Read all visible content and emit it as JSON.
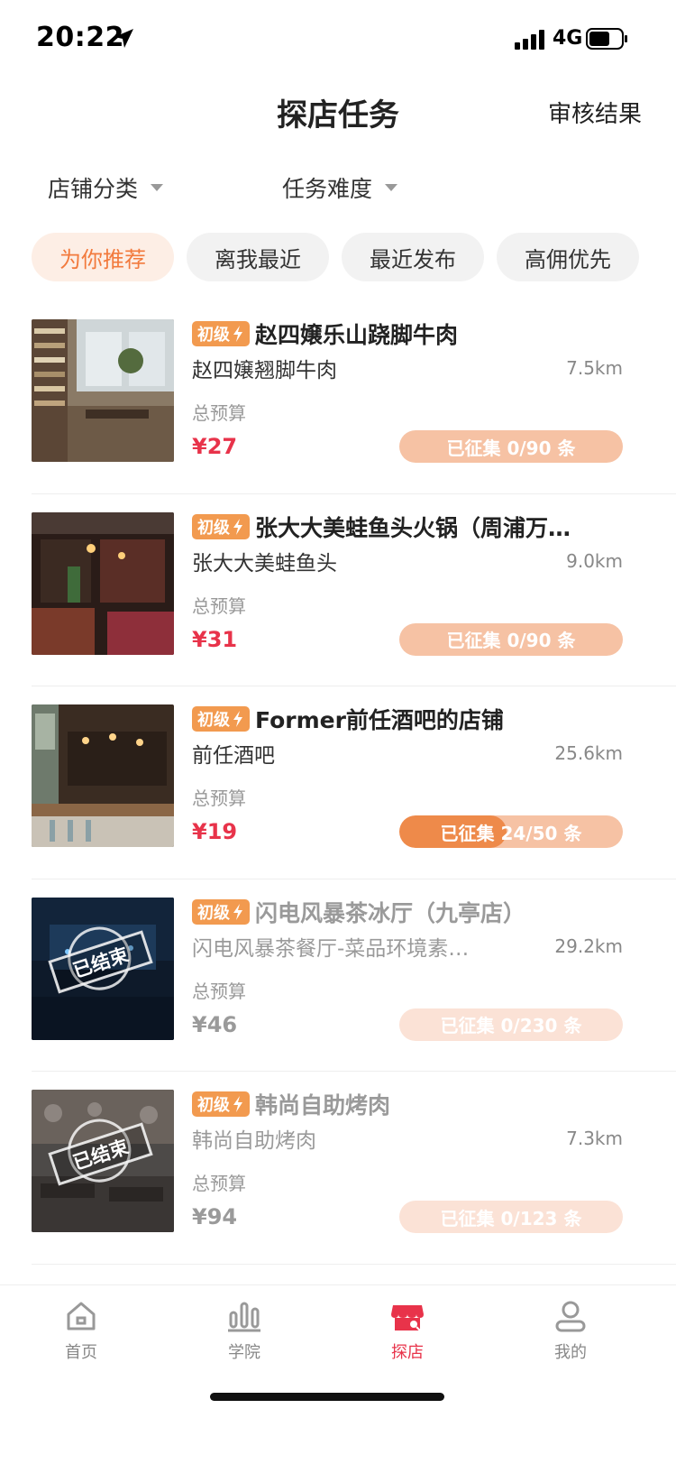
{
  "status_bar": {
    "time": "20:22",
    "network": "4G"
  },
  "header": {
    "title": "探店任务",
    "review_link": "审核结果"
  },
  "filters": {
    "category": "店铺分类",
    "difficulty": "任务难度"
  },
  "sort_tabs": [
    {
      "label": "为你推荐",
      "active": true
    },
    {
      "label": "离我最近",
      "active": false
    },
    {
      "label": "最近发布",
      "active": false
    },
    {
      "label": "高佣优先",
      "active": false
    }
  ],
  "tasks": [
    {
      "level": "初级",
      "title": "赵四嬢乐山跷脚牛肉",
      "store": "赵四嬢翘脚牛肉",
      "distance": "7.5km",
      "budget_label": "总预算",
      "price": "¥27",
      "progress": "已征集 0/90 条",
      "collected": 0,
      "total": 90,
      "ended": false,
      "image": "bookstore-cafe-photo"
    },
    {
      "level": "初级",
      "title": "张大大美蛙鱼头火锅（周浦万…",
      "store": "张大大美蛙鱼头",
      "distance": "9.0km",
      "budget_label": "总预算",
      "price": "¥31",
      "progress": "已征集 0/90 条",
      "collected": 0,
      "total": 90,
      "ended": false,
      "image": "restaurant-interior-photo"
    },
    {
      "level": "初级",
      "title": "Former前任酒吧的店铺",
      "store": "前任酒吧",
      "distance": "25.6km",
      "budget_label": "总预算",
      "price": "¥19",
      "progress": "已征集 24/50 条",
      "collected": 24,
      "total": 50,
      "ended": false,
      "image": "bar-interior-photo"
    },
    {
      "level": "初级",
      "title": "闪电风暴茶冰厅（九亭店）",
      "store": "闪电风暴茶餐厅-菜品环境素…",
      "distance": "29.2km",
      "budget_label": "总预算",
      "price": "¥46",
      "progress": "已征集 0/230 条",
      "collected": 0,
      "total": 230,
      "ended": true,
      "stamp": "已结束",
      "image": "neon-tea-house-photo"
    },
    {
      "level": "初级",
      "title": "韩尚自助烤肉",
      "store": "韩尚自助烤肉",
      "distance": "7.3km",
      "budget_label": "总预算",
      "price": "¥94",
      "progress": "已征集 0/123 条",
      "collected": 0,
      "total": 123,
      "ended": true,
      "stamp": "已结束",
      "image": "bbq-restaurant-photo"
    }
  ],
  "tab_bar": [
    {
      "label": "首页",
      "icon": "home-icon",
      "active": false
    },
    {
      "label": "学院",
      "icon": "academy-icon",
      "active": false
    },
    {
      "label": "探店",
      "icon": "store-explore-icon",
      "active": true
    },
    {
      "label": "我的",
      "icon": "profile-icon",
      "active": false
    }
  ],
  "colors": {
    "accent": "#e8334a",
    "orange": "#f27a3d",
    "badge": "#f29a4f",
    "pill": "#f6c2a4",
    "pill_fill": "#ee8a4a"
  }
}
